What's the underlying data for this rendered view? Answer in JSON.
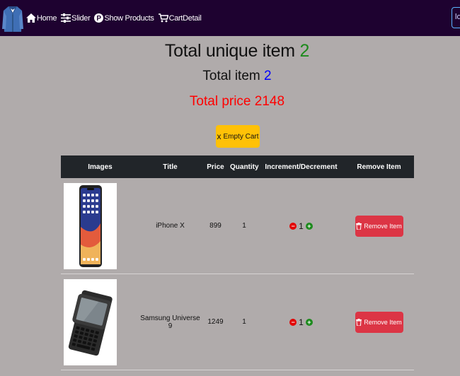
{
  "nav": {
    "items": [
      {
        "label": "Home",
        "icon": "home-icon"
      },
      {
        "label": "Slider",
        "icon": "sliders-icon"
      },
      {
        "label": "Show Products",
        "icon": "parking-p-icon"
      },
      {
        "label": "CartDetail",
        "icon": "cart-icon"
      }
    ],
    "login_text": "lo"
  },
  "summary": {
    "unique_label": "Total unique item",
    "unique_value": "2",
    "total_label": "Total item",
    "total_value": "2",
    "price_label": "Total price",
    "price_value": "2148"
  },
  "empty_cart": {
    "icon": "x",
    "label": "Empty Cart"
  },
  "table": {
    "headers": [
      "Images",
      "Title",
      "Price",
      "Quantity",
      "Increment/Decrement",
      "Remove Item"
    ],
    "rows": [
      {
        "title": "iPhone X",
        "price": "899",
        "quantity": "1",
        "count": "1",
        "remove_label": "Remove Item"
      },
      {
        "title": "Samsung Universe 9",
        "price": "1249",
        "quantity": "1",
        "count": "1",
        "remove_label": "Remove Item"
      }
    ]
  },
  "colors": {
    "navbar": "#1e0230",
    "background": "#b0abab",
    "accent_green": "#1d8a1d",
    "accent_blue": "#0000ff",
    "price_red": "#ff0000",
    "warning": "#ffc107",
    "danger": "#dc3545"
  }
}
